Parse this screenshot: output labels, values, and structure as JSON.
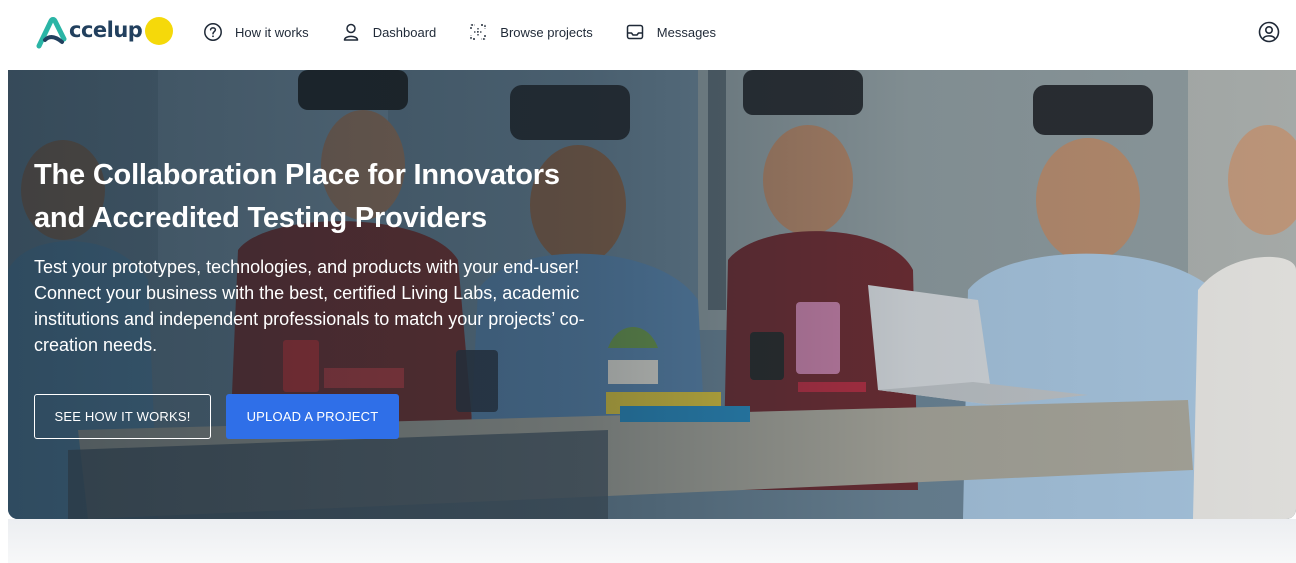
{
  "brand": {
    "name": "ccelup",
    "tagline": "",
    "badge_text": ""
  },
  "nav": {
    "items": [
      {
        "label": "How it works",
        "icon": "help-circle-icon"
      },
      {
        "label": "Dashboard",
        "icon": "user-icon"
      },
      {
        "label": "Browse projects",
        "icon": "focus-scan-icon"
      },
      {
        "label": "Messages",
        "icon": "inbox-icon"
      }
    ],
    "profile_icon": "account-circle-icon"
  },
  "hero": {
    "title_line1": "The Collaboration Place for Innovators",
    "title_line2": "and Accredited Testing Providers",
    "description": "Test your prototypes, technologies, and products with your end-user! Connect your business with the best, certified Living Labs, academic institutions and independent professionals to match your projects’ co-creation needs.",
    "secondary_button": "SEE HOW IT WORKS!",
    "primary_button": "UPLOAD A PROJECT"
  },
  "colors": {
    "accent": "#2f6fe8",
    "logo_text": "#22405e",
    "logo_badge": "#f5d90a",
    "nav_text": "#1f2937"
  }
}
